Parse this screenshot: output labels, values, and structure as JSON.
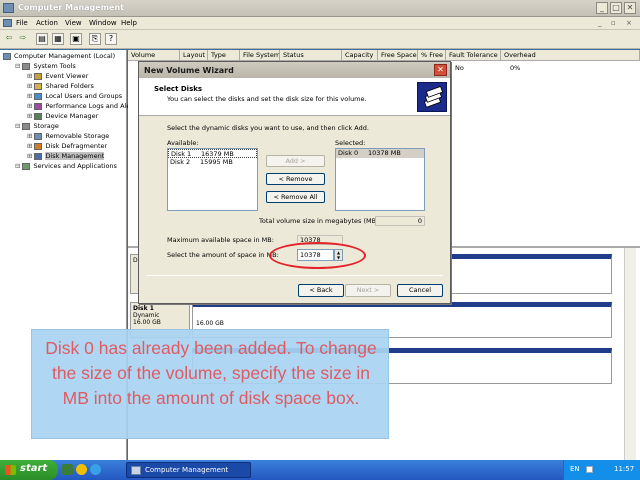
{
  "window": {
    "title": "Computer Management"
  },
  "menu": [
    "File",
    "Action",
    "View",
    "Window",
    "Help"
  ],
  "tree": [
    {
      "label": "Computer Management (Local)",
      "indent": 0
    },
    {
      "label": "System Tools",
      "indent": 1
    },
    {
      "label": "Event Viewer",
      "indent": 2
    },
    {
      "label": "Shared Folders",
      "indent": 2
    },
    {
      "label": "Local Users and Groups",
      "indent": 2
    },
    {
      "label": "Performance Logs and Alerts",
      "indent": 2
    },
    {
      "label": "Device Manager",
      "indent": 2
    },
    {
      "label": "Storage",
      "indent": 1
    },
    {
      "label": "Removable Storage",
      "indent": 2
    },
    {
      "label": "Disk Defragmenter",
      "indent": 2
    },
    {
      "label": "Disk Management",
      "indent": 2
    },
    {
      "label": "Services and Applications",
      "indent": 1
    }
  ],
  "columns": [
    "Volume",
    "Layout",
    "Type",
    "File System",
    "Status",
    "Capacity",
    "Free Space",
    "% Free",
    "Fault Tolerance",
    "Overhead"
  ],
  "row": {
    "fault_tolerance": "No",
    "overhead": "0%"
  },
  "disk1": {
    "name": "Disk 1",
    "type": "Dynamic",
    "size": "16.00 GB",
    "volume_size": "16.00 GB",
    "top_label": "D"
  },
  "wizard": {
    "title": "New Volume Wizard",
    "header_title": "Select Disks",
    "header_subtitle": "You can select the disks and set the disk size for this volume.",
    "instruction": "Select the dynamic disks you want to use, and then click Add.",
    "available_label": "Available:",
    "selected_label": "Selected:",
    "available": [
      {
        "disk": "Disk 1",
        "size": "16379 MB"
      },
      {
        "disk": "Disk 2",
        "size": "15995 MB"
      }
    ],
    "selected": [
      {
        "disk": "Disk 0",
        "size": "10378 MB"
      }
    ],
    "add_button": "Add >",
    "remove_button": "< Remove",
    "remove_all_button": "< Remove All",
    "total_label": "Total volume size in megabytes (MB):",
    "total_value": "0",
    "max_label": "Maximum available space in MB:",
    "max_value": "10378",
    "amount_label": "Select the amount of space in MB:",
    "amount_value": "10378",
    "back_button": "< Back",
    "next_button": "Next >",
    "cancel_button": "Cancel"
  },
  "callout": "Disk 0 has already been added. To change the size of the volume, specify the size in MB into the amount of disk space box.",
  "taskbar": {
    "start": "start",
    "task": "Computer Management",
    "lang": "EN",
    "time": "11:57"
  },
  "colors": {
    "taskbar": "#2457c1",
    "start": "#3fae3a",
    "callout_text": "#e05a62",
    "highlight": "#e4222a"
  }
}
